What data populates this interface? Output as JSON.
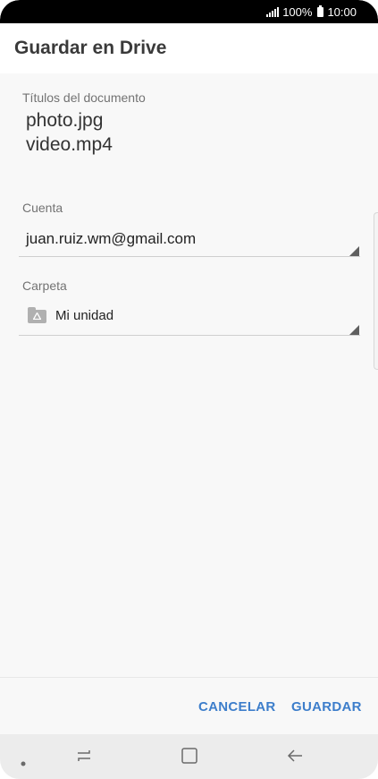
{
  "status_bar": {
    "battery": "100%",
    "time": "10:00"
  },
  "header": {
    "title": "Guardar en Drive"
  },
  "form": {
    "documents_label": "Títulos del documento",
    "documents": [
      "photo.jpg",
      "video.mp4"
    ],
    "account_label": "Cuenta",
    "account_value": "juan.ruiz.wm@gmail.com",
    "folder_label": "Carpeta",
    "folder_value": "Mi unidad"
  },
  "actions": {
    "cancel_label": "CANCELAR",
    "save_label": "GUARDAR"
  },
  "nav": {
    "icons": [
      "dot-icon",
      "recent-apps-icon",
      "home-icon",
      "back-icon"
    ]
  },
  "colors": {
    "accent": "#3d7ecb",
    "status_bar": "#000000",
    "background": "#f8f8f8"
  }
}
